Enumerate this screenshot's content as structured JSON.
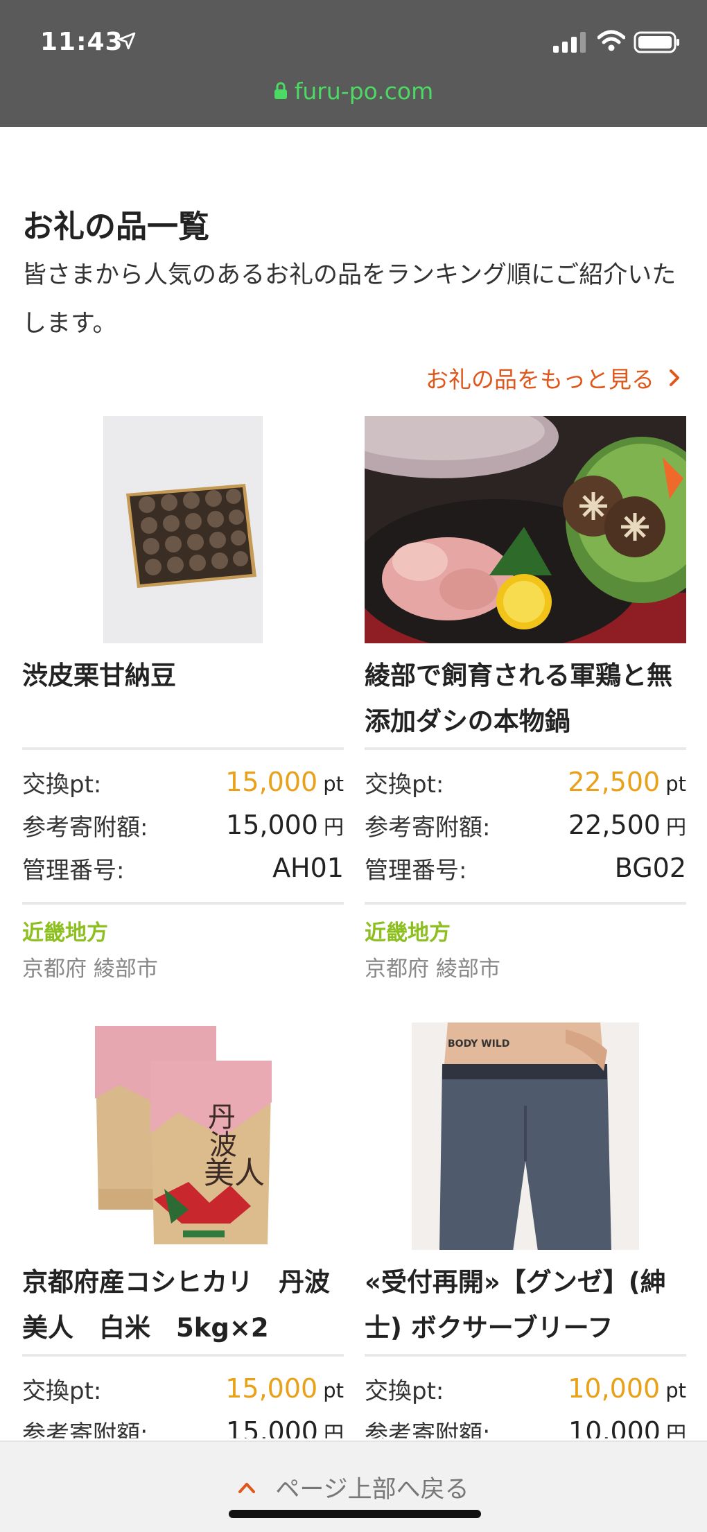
{
  "status_bar": {
    "time": "11:43"
  },
  "browser": {
    "url": "furu-po.com"
  },
  "section": {
    "title": "お礼の品一覧",
    "description": "皆さまから人気のあるお礼の品をランキング順にご紹介いたします。",
    "more_link": "お礼の品をもっと見る"
  },
  "labels": {
    "exchange": "交換pt:",
    "donation": "参考寄附額:",
    "manage": "管理番号:",
    "pt_unit": "pt",
    "yen_unit": "円"
  },
  "products": [
    {
      "name": "渋皮栗甘納豆",
      "pt": "15,000",
      "donation": "15,000",
      "code": "AH01",
      "region": "近畿地方",
      "city": "京都府 綾部市"
    },
    {
      "name": "綾部で飼育される軍鶏と無添加ダシの本物鍋",
      "pt": "22,500",
      "donation": "22,500",
      "code": "BG02",
      "region": "近畿地方",
      "city": "京都府 綾部市"
    },
    {
      "name": "京都府産コシヒカリ　丹波美人　白米　5kg×2",
      "pt": "15,000",
      "donation": "15,000"
    },
    {
      "name": "«受付再開»【グンゼ】(紳士) ボクサーブリーフ",
      "pt": "10,000",
      "donation": "10,000",
      "image_text": "BODY WILD"
    }
  ],
  "footer": {
    "back_to_top": "ページ上部へ戻る"
  },
  "colors": {
    "accent_orange": "#e0571b",
    "points_gold": "#e8a118",
    "region_green": "#8cbf1f",
    "url_green": "#4cd964"
  }
}
